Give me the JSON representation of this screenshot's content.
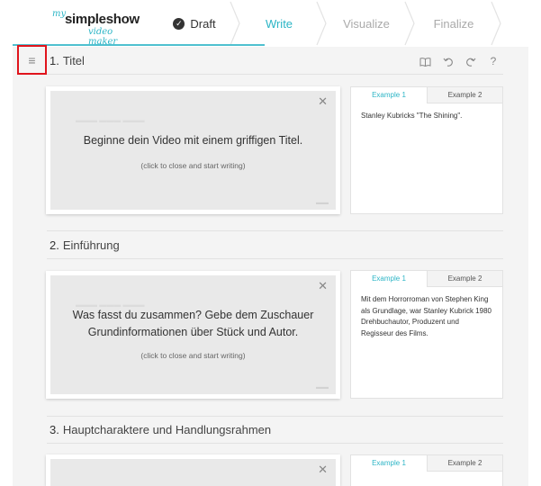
{
  "logo": {
    "prefix": "my",
    "name": "simpleshow",
    "tagline": "video maker"
  },
  "steps": [
    {
      "label": "Draft",
      "state": "done",
      "icon": "check-circle-icon"
    },
    {
      "label": "Write",
      "state": "active"
    },
    {
      "label": "Visualize",
      "state": "upcoming"
    },
    {
      "label": "Finalize",
      "state": "upcoming"
    }
  ],
  "toolbar": {
    "menu_icon": "≡",
    "book_icon": "book-icon",
    "undo_icon": "undo-icon",
    "redo_icon": "redo-icon",
    "help_label": "?"
  },
  "sections": [
    {
      "number": "1.",
      "title": "Titel",
      "card_heading_lines": [
        "Beginne dein Video mit einem griffigen Titel."
      ],
      "card_hint": "(click to close and start writing)",
      "examples": {
        "tab1": "Example 1",
        "tab2": "Example 2",
        "text": "Stanley Kubricks \"The Shining\"."
      }
    },
    {
      "number": "2.",
      "title": "Einführung",
      "card_heading_lines": [
        "Was fasst du zusammen? Gebe dem Zuschauer",
        "Grundinformationen über Stück und Autor."
      ],
      "card_hint": "(click to close and start writing)",
      "examples": {
        "tab1": "Example 1",
        "tab2": "Example 2",
        "text": "Mit dem Horrorroman von Stephen King als Grundlage, war Stanley Kubrick 1980 Drehbuchautor, Produzent und Regisseur des Films."
      }
    },
    {
      "number": "3.",
      "title": "Hauptcharaktere und Handlungsrahmen",
      "examples": {
        "tab1": "Example 1",
        "tab2": "Example 2"
      }
    }
  ],
  "colors": {
    "accent": "#2cb5c6",
    "highlight": "#e0141c",
    "panel": "#f4f4f4"
  }
}
